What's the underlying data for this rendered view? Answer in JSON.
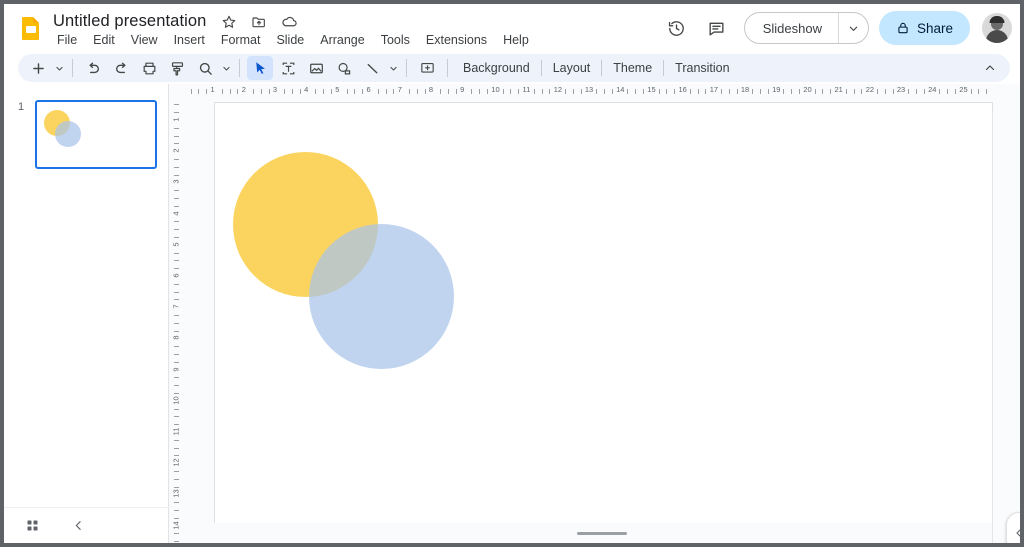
{
  "app": {
    "name": "Google Slides",
    "logo_icon": "slides-logo-icon"
  },
  "header": {
    "title": "Untitled presentation",
    "title_icons": [
      {
        "name": "star-icon",
        "label": "Star"
      },
      {
        "name": "move-to-folder-icon",
        "label": "Move"
      },
      {
        "name": "cloud-saved-icon",
        "label": "Saved to Drive"
      }
    ],
    "menus": [
      "File",
      "Edit",
      "View",
      "Insert",
      "Format",
      "Slide",
      "Arrange",
      "Tools",
      "Extensions",
      "Help"
    ],
    "history_icon": "version-history-icon",
    "comment_icon": "comment-icon",
    "slideshow_label": "Slideshow",
    "slideshow_caret_icon": "chevron-down-icon",
    "share_label": "Share",
    "share_lock_icon": "lock-icon",
    "share_bg": "#c2e7ff",
    "avatar_name": "account-avatar"
  },
  "toolbar": {
    "icons": [
      {
        "name": "new-slide-icon",
        "label": "New slide"
      },
      {
        "name": "undo-icon",
        "label": "Undo"
      },
      {
        "name": "redo-icon",
        "label": "Redo"
      },
      {
        "name": "print-icon",
        "label": "Print"
      },
      {
        "name": "paint-format-icon",
        "label": "Paint format"
      },
      {
        "name": "zoom-icon",
        "label": "Zoom"
      },
      {
        "name": "select-icon",
        "label": "Select"
      },
      {
        "name": "text-box-icon",
        "label": "Text box"
      },
      {
        "name": "insert-image-icon",
        "label": "Image"
      },
      {
        "name": "shape-icon",
        "label": "Shape"
      },
      {
        "name": "line-icon",
        "label": "Line"
      },
      {
        "name": "add-comment-icon",
        "label": "Comment"
      }
    ],
    "text_buttons": [
      "Background",
      "Layout",
      "Theme",
      "Transition"
    ],
    "collapse_icon": "chevron-up-icon",
    "active_tool": "select-icon",
    "active_bg": "#d3e3fd",
    "bar_bg": "#eef3fb"
  },
  "filmstrip": {
    "slides": [
      {
        "number": "1",
        "selected": true
      }
    ],
    "selected_border": "#1a73e8",
    "grid_view_icon": "grid-view-icon",
    "collapse_icon": "chevron-left-icon"
  },
  "rulers": {
    "horizontal_labels": [
      "1",
      "2",
      "3",
      "4",
      "5",
      "6",
      "7",
      "8",
      "9",
      "10",
      "11",
      "12",
      "13",
      "14",
      "15",
      "16",
      "17",
      "18",
      "19",
      "20",
      "21",
      "22",
      "23",
      "24",
      "25"
    ],
    "vertical_labels": [
      "1",
      "2",
      "3",
      "4",
      "5",
      "6",
      "7",
      "8",
      "9",
      "10",
      "11",
      "12",
      "13",
      "14"
    ],
    "tick_color": "#9aa0a6",
    "label_color": "#5f6368"
  },
  "canvas": {
    "background": "#ffffff",
    "shapes": [
      {
        "name": "yellow-circle",
        "type": "ellipse",
        "fill": "#fbd45f",
        "opacity": 1
      },
      {
        "name": "blue-circle",
        "type": "ellipse",
        "fill": "#a8c4ea",
        "opacity": 0.72
      }
    ],
    "notes_handle": "notes-resize-handle",
    "expand_panel_icon": "chevron-left-icon"
  }
}
